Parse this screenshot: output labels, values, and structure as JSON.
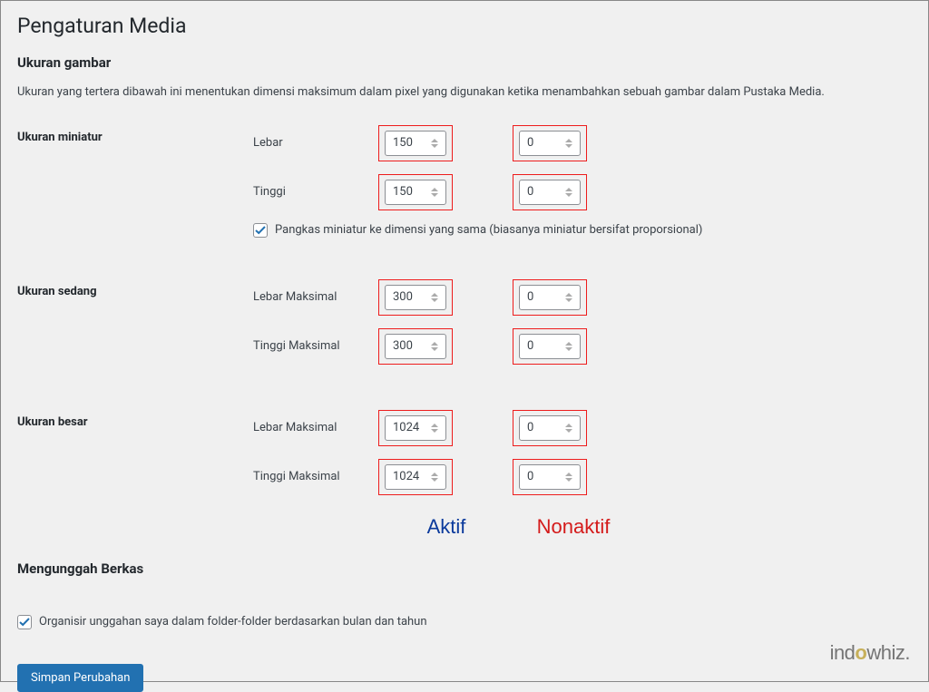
{
  "page_title": "Pengaturan Media",
  "sections": {
    "image_sizes": {
      "heading": "Ukuran gambar",
      "description": "Ukuran yang tertera dibawah ini menentukan dimensi maksimum dalam pixel yang digunakan ketika menambahkan sebuah gambar dalam Pustaka Media."
    },
    "thumbnail": {
      "label": "Ukuran miniatur",
      "width_label": "Lebar",
      "height_label": "Tinggi",
      "width_value": "150",
      "height_value": "150",
      "inactive_value": "0",
      "crop_label": "Pangkas miniatur ke dimensi yang sama (biasanya miniatur bersifat proporsional)",
      "crop_checked": true
    },
    "medium": {
      "label": "Ukuran sedang",
      "width_label": "Lebar Maksimal",
      "height_label": "Tinggi Maksimal",
      "width_value": "300",
      "height_value": "300",
      "inactive_value": "0"
    },
    "large": {
      "label": "Ukuran besar",
      "width_label": "Lebar Maksimal",
      "height_label": "Tinggi Maksimal",
      "width_value": "1024",
      "height_value": "1024",
      "inactive_value": "0"
    },
    "annotations": {
      "active": "Aktif",
      "inactive": "Nonaktif"
    },
    "uploading": {
      "heading": "Mengunggah Berkas",
      "organize_label": "Organisir unggahan saya dalam folder-folder berdasarkan bulan dan tahun",
      "organize_checked": true
    }
  },
  "submit_label": "Simpan Perubahan",
  "watermark": {
    "part1": "ind",
    "o": "o",
    "part2": "whiz."
  }
}
